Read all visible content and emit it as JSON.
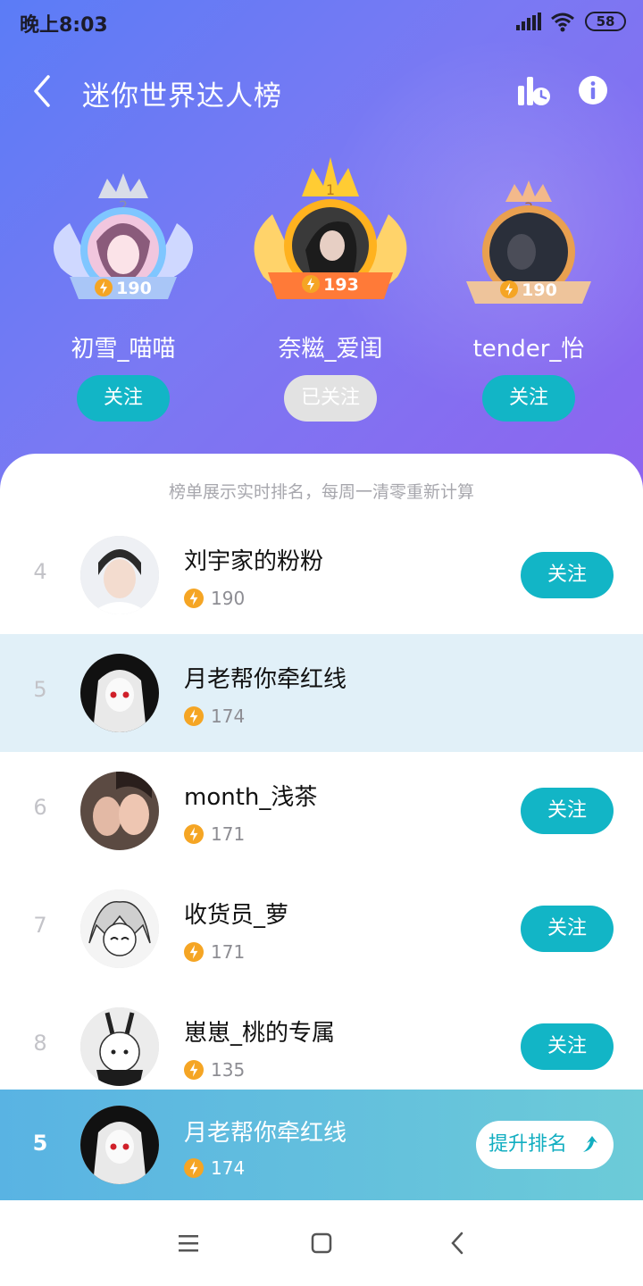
{
  "status": {
    "time": "晚上8:03",
    "battery": "58"
  },
  "header": {
    "title": "迷你世界达人榜",
    "icons": [
      "back-icon",
      "stats-clock-icon",
      "info-icon"
    ]
  },
  "podium": [
    {
      "rank": "2",
      "name": "初雪_喵喵",
      "score": "190",
      "button": "关注",
      "followed": false
    },
    {
      "rank": "1",
      "name": "奈糍_爱闺",
      "score": "193",
      "button": "已关注",
      "followed": true
    },
    {
      "rank": "3",
      "name": "tender_怡",
      "score": "190",
      "button": "关注",
      "followed": false
    }
  ],
  "notice": "榜单展示实时排名，每周一清零重新计算",
  "list": [
    {
      "rank": "4",
      "name": "刘宇家的粉粉",
      "score": "190",
      "button": "关注"
    },
    {
      "rank": "5",
      "name": "月老帮你牵红线",
      "score": "174",
      "button": ""
    },
    {
      "rank": "6",
      "name": "month_浅茶",
      "score": "171",
      "button": "关注"
    },
    {
      "rank": "7",
      "name": "收货员_萝",
      "score": "171",
      "button": "关注"
    },
    {
      "rank": "8",
      "name": "崽崽_桃的专属",
      "score": "135",
      "button": "关注"
    }
  ],
  "me": {
    "rank": "5",
    "name": "月老帮你牵红线",
    "score": "174",
    "button": "提升排名"
  },
  "colors": {
    "accent": "#12b5c6",
    "header_start": "#5b7cf6",
    "header_end": "#8e64ef",
    "highlight_row": "#e1f0f8",
    "bolt": "#f5a524"
  }
}
